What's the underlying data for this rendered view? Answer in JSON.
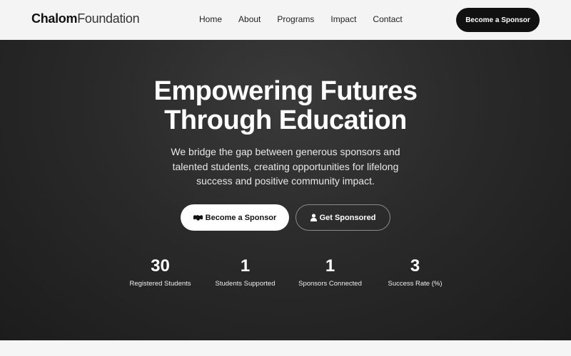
{
  "brand": {
    "bold": "Chalom",
    "light": "Foundation"
  },
  "nav": {
    "links": [
      "Home",
      "About",
      "Programs",
      "Impact",
      "Contact"
    ],
    "cta": "Become a Sponsor"
  },
  "hero": {
    "title_line1": "Empowering Futures",
    "title_line2": "Through Education",
    "subtitle": "We bridge the gap between generous sponsors and talented students, creating opportunities for lifelong success and positive community impact.",
    "primary_button": {
      "label": "Become a Sponsor",
      "icon": "handshake-icon"
    },
    "secondary_button": {
      "label": "Get Sponsored",
      "icon": "user-icon"
    }
  },
  "stats": [
    {
      "value": "30",
      "label": "Registered Students"
    },
    {
      "value": "1",
      "label": "Students Supported"
    },
    {
      "value": "1",
      "label": "Sponsors Connected"
    },
    {
      "value": "3",
      "label": "Success Rate (%)"
    }
  ],
  "colors": {
    "hero_bg": "#2a2a2a",
    "nav_bg": "#f4f4f4",
    "button_dark": "#111111",
    "button_light": "#ffffff"
  }
}
